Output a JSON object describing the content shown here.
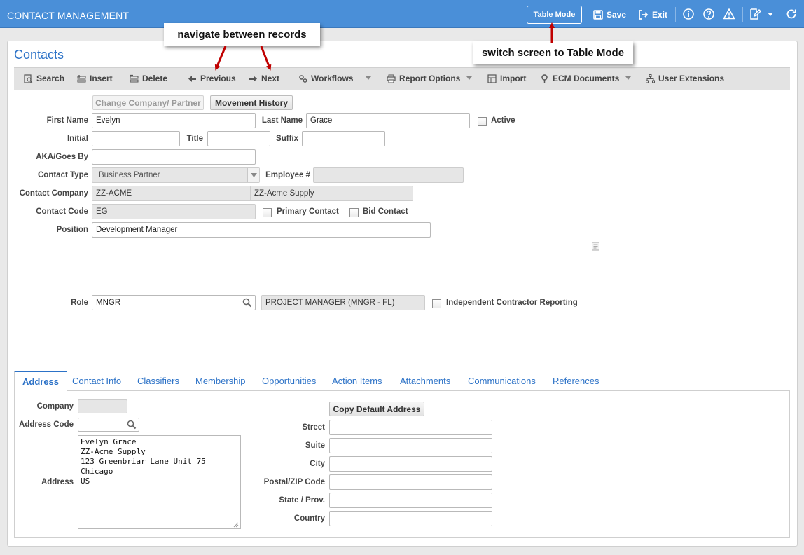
{
  "app": {
    "title": "CONTACT MANAGEMENT",
    "table_mode_label": "Table Mode",
    "save_label": "Save",
    "exit_label": "Exit"
  },
  "page": {
    "title": "Contacts"
  },
  "toolbar": {
    "search": "Search",
    "insert": "Insert",
    "delete": "Delete",
    "previous": "Previous",
    "next": "Next",
    "workflows": "Workflows",
    "report_options": "Report Options",
    "import": "Import",
    "ecm_documents": "ECM Documents",
    "user_extensions": "User Extensions"
  },
  "buttons": {
    "change_company": "Change Company/ Partner",
    "movement_history": "Movement History",
    "copy_default_address": "Copy Default Address"
  },
  "form": {
    "first_name": {
      "label": "First Name",
      "value": "Evelyn"
    },
    "last_name": {
      "label": "Last Name",
      "value": "Grace"
    },
    "active": {
      "label": "Active",
      "checked": false
    },
    "initial": {
      "label": "Initial",
      "value": ""
    },
    "title": {
      "label": "Title",
      "value": ""
    },
    "suffix": {
      "label": "Suffix",
      "value": ""
    },
    "aka": {
      "label": "AKA/Goes By",
      "value": ""
    },
    "contact_type": {
      "label": "Contact Type",
      "value": "Business Partner"
    },
    "employee_no": {
      "label": "Employee #",
      "value": ""
    },
    "contact_company": {
      "label": "Contact Company",
      "code": "ZZ-ACME",
      "name": "ZZ-Acme Supply"
    },
    "contact_code": {
      "label": "Contact Code",
      "value": "EG"
    },
    "primary_contact": {
      "label": "Primary Contact",
      "checked": false
    },
    "bid_contact": {
      "label": "Bid Contact",
      "checked": false
    },
    "position": {
      "label": "Position",
      "value": "Development Manager"
    },
    "role": {
      "label": "Role",
      "value": "MNGR",
      "description": "PROJECT MANAGER (MNGR - FL)"
    },
    "independent_contractor": {
      "label": "Independent Contractor Reporting",
      "checked": false
    }
  },
  "tabs": [
    "Address",
    "Contact Info",
    "Classifiers",
    "Membership",
    "Opportunities",
    "Action Items",
    "Attachments",
    "Communications",
    "References"
  ],
  "address_tab": {
    "company": {
      "label": "Company",
      "value": ""
    },
    "address_code": {
      "label": "Address Code",
      "value": ""
    },
    "address": {
      "label": "Address",
      "value": "Evelyn Grace\nZZ-Acme Supply\n123 Greenbriar Lane Unit 75\nChicago\nUS"
    },
    "street": {
      "label": "Street",
      "value": ""
    },
    "suite": {
      "label": "Suite",
      "value": ""
    },
    "city": {
      "label": "City",
      "value": ""
    },
    "postal": {
      "label": "Postal/ZIP Code",
      "value": ""
    },
    "state": {
      "label": "State / Prov.",
      "value": ""
    },
    "country": {
      "label": "Country",
      "value": ""
    }
  },
  "annotations": {
    "navigate": "navigate between records",
    "switch": "switch screen to Table Mode"
  },
  "colors": {
    "topbar": "#4a8fd8",
    "accent": "#2c72c7",
    "arrow": "#c00000"
  }
}
